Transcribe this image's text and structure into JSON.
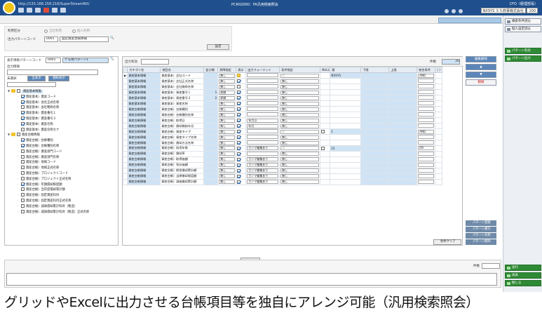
{
  "topbar": {
    "url": "http://133.166.158.216/SuperStreamNX/",
    "screen_code": "PCR02000：FA汎用検索照会",
    "user": "CFO（経理部長）",
    "company": "NXSYS ＳＳ商事株式会社",
    "zoom": "100"
  },
  "sidebar": {
    "buttons": [
      "検索条件読込",
      "個人設定読込",
      "パターン有効",
      "パターン出力",
      "実行",
      "再表",
      "閉じる"
    ],
    "colors": {
      "green": "#2f8a35"
    }
  },
  "condition": {
    "usage_label": "利用区分",
    "radio1": "全社利用",
    "radio2": "個人利用",
    "output_pattern_label": "出力パターンコード",
    "output_pattern_code": "0001",
    "output_pattern_name": "固定資産台帳情報",
    "set_button": "設定"
  },
  "left": {
    "display_pattern_label": "表示項目パターンコード",
    "display_pattern_code": "0001",
    "display_pattern_name": "デモ用パターン1",
    "output_info_label": "出力情報",
    "no_select_label": "未選択",
    "show_all": "全表示",
    "select_show": "選択表示"
  },
  "tree": [
    {
      "label": "資産基本情報",
      "level": 0,
      "check": false,
      "folder": true,
      "hl": true
    },
    {
      "label": "資産基本）資産コード",
      "level": 1,
      "check": true
    },
    {
      "label": "資産基本）会社正式名称",
      "level": 1,
      "check": true
    },
    {
      "label": "資産基本）会社略称名称",
      "level": 1,
      "check": false
    },
    {
      "label": "資産基本）資産番号１",
      "level": 1,
      "check": true
    },
    {
      "label": "資産基本）資産番号２",
      "level": 1,
      "check": true
    },
    {
      "label": "資産基本）資産名称",
      "level": 1,
      "check": true
    },
    {
      "label": "資産基本）資産名称カナ",
      "level": 1,
      "check": false
    },
    {
      "label": "資産台帳情報",
      "level": 0,
      "check": false,
      "folder": true
    },
    {
      "label": "資産台帳）台帳種別",
      "level": 1,
      "check": true
    },
    {
      "label": "資産台帳）台帳種別名称",
      "level": 1,
      "check": true
    },
    {
      "label": "資産台帳）資産部門コード",
      "level": 1,
      "check": false
    },
    {
      "label": "資産台帳）資産部門名称",
      "level": 1,
      "check": false
    },
    {
      "label": "資産台帳）地域コード",
      "level": 1,
      "check": false
    },
    {
      "label": "資産台帳）地域正式名称",
      "level": 1,
      "check": false
    },
    {
      "label": "資産台帳）プロジェクトコード",
      "level": 1,
      "check": false
    },
    {
      "label": "資産台帳）プロジェクト正式名称",
      "level": 1,
      "check": false
    },
    {
      "label": "資産台帳）年額償却限度額",
      "level": 1,
      "check": true
    },
    {
      "label": "資産台帳）当年度償却累計額",
      "level": 1,
      "check": false
    },
    {
      "label": "資産台帳）固定資産科目",
      "level": 1,
      "check": false
    },
    {
      "label": "資産台帳）固定資産科目正式名称",
      "level": 1,
      "check": false
    },
    {
      "label": "資産台帳）減価償却累計科目（製造）",
      "level": 1,
      "check": false
    },
    {
      "label": "資産台帳）減価償却累計科目（製造）正式名称",
      "level": 1,
      "check": false
    }
  ],
  "grid": {
    "output_order_label": "出力有効",
    "count_label": "件数",
    "count": "20",
    "headers": [
      "",
      "カテゴリ名",
      "項目名",
      "並び順",
      "昇降指定",
      "表示",
      "出力フォーマット",
      "条件指定",
      "NULL",
      "値",
      "下限",
      "上限",
      "結合条件",
      "(  )"
    ],
    "rows": [
      {
        "cat": "資産基本情報",
        "item": "資産基本）会社コード",
        "order": "",
        "sort": "無し",
        "show": "y",
        "fmt": "",
        "cond": "＝",
        "null": "",
        "val": "NXSYS",
        "join": "AND",
        "b": true
      },
      {
        "cat": "資産基本情報",
        "item": "資産基本）会社正式名称",
        "order": "",
        "sort": "無し",
        "show": "c",
        "fmt": "",
        "cond": "無し",
        "null": "",
        "val": "",
        "join": "",
        "b": false
      },
      {
        "cat": "資産基本情報",
        "item": "資産基本）会社略称名称",
        "order": "",
        "sort": "無し",
        "show": "n",
        "fmt": "",
        "cond": "無し",
        "null": "",
        "val": "",
        "join": "",
        "b": false
      },
      {
        "cat": "資産基本情報",
        "item": "資産基本）資産番号１",
        "order": "1",
        "sort": "昇順",
        "show": "c",
        "fmt": "",
        "cond": "無し",
        "null": "",
        "val": "",
        "join": "",
        "b": false
      },
      {
        "cat": "資産基本情報",
        "item": "資産基本）資産番号２",
        "order": "2",
        "sort": "昇順",
        "show": "c",
        "fmt": "",
        "cond": "無し",
        "null": "",
        "val": "",
        "join": "",
        "b": false
      },
      {
        "cat": "資産基本情報",
        "item": "資産基本）資産名称",
        "order": "",
        "sort": "無し",
        "show": "c",
        "fmt": "",
        "cond": "無し",
        "null": "",
        "val": "",
        "join": "",
        "b": false
      },
      {
        "cat": "資産台帳情報",
        "item": "資産台帳）台帳種別",
        "order": "",
        "sort": "無し",
        "show": "c",
        "fmt": "",
        "cond": "無し",
        "null": "",
        "val": "",
        "join": "",
        "b": false
      },
      {
        "cat": "資産台帳情報",
        "item": "資産台帳）台帳種別名称",
        "order": "",
        "sort": "無し",
        "show": "c",
        "fmt": "",
        "cond": "無し",
        "null": "",
        "val": "",
        "join": "",
        "b": false
      },
      {
        "cat": "資産台帳情報",
        "item": "資産台帳）取得日",
        "order": "",
        "sort": "無し",
        "show": "c",
        "fmt": "年月日",
        "cond": "無し",
        "null": "",
        "val": "",
        "join": "",
        "b": false
      },
      {
        "cat": "資産台帳情報",
        "item": "資産台帳）償却開始年月",
        "order": "",
        "sort": "無し",
        "show": "c",
        "fmt": "年月",
        "cond": "無し",
        "null": "",
        "val": "",
        "join": "",
        "b": false
      },
      {
        "cat": "資産台帳情報",
        "item": "資産台帳）資産タイプ",
        "order": "",
        "sort": "無し",
        "show": "c",
        "fmt": "",
        "cond": "＝",
        "null": "n",
        "val": "1",
        "join": "AND",
        "b": true
      },
      {
        "cat": "資産台帳情報",
        "item": "資産台帳）資産タイプ名称",
        "order": "",
        "sort": "無し",
        "show": "c",
        "fmt": "",
        "cond": "無し",
        "null": "",
        "val": "",
        "join": "",
        "b": false
      },
      {
        "cat": "資産台帳情報",
        "item": "資産台帳）償却方法名称",
        "order": "",
        "sort": "無し",
        "show": "c",
        "fmt": "",
        "cond": "無し",
        "null": "",
        "val": "",
        "join": "",
        "b": false
      },
      {
        "cat": "資産台帳情報",
        "item": "資産台帳）耐用年数",
        "order": "",
        "sort": "無し",
        "show": "c",
        "fmt": "カンマ編集あり",
        "cond": "＝",
        "null": "n",
        "val": "15",
        "join": "OR",
        "b": true
      },
      {
        "cat": "資産台帳情報",
        "item": "資産台帳）償却率",
        "order": "",
        "sort": "無し",
        "show": "c",
        "fmt": "",
        "cond": "無し",
        "null": "",
        "val": "",
        "join": "",
        "b": false
      },
      {
        "cat": "資産台帳情報",
        "item": "資産台帳）取得価額",
        "order": "",
        "sort": "無し",
        "show": "c",
        "fmt": "カンマ編集あり",
        "cond": "無し",
        "null": "",
        "val": "",
        "join": "",
        "b": false
      },
      {
        "cat": "資産台帳情報",
        "item": "資産台帳）残存価額",
        "order": "",
        "sort": "無し",
        "show": "c",
        "fmt": "カンマ編集あり",
        "cond": "無し",
        "null": "",
        "val": "",
        "join": "",
        "b": false
      },
      {
        "cat": "資産台帳情報",
        "item": "資産台帳）期首償却累計額",
        "order": "",
        "sort": "無し",
        "show": "c",
        "fmt": "カンマ編集あり",
        "cond": "無し",
        "null": "",
        "val": "",
        "join": "",
        "b": false
      },
      {
        "cat": "資産台帳情報",
        "item": "資産台帳）当期償却限度額",
        "order": "",
        "sort": "無し",
        "show": "c",
        "fmt": "カンマ編集あり",
        "cond": "無し",
        "null": "",
        "val": "",
        "join": "",
        "b": false
      },
      {
        "cat": "資産台帳情報",
        "item": "資産台帳）減価償却累計額",
        "order": "",
        "sort": "無し",
        "show": "c",
        "fmt": "カンマ編集あり",
        "cond": "無し",
        "null": "",
        "val": "",
        "join": "",
        "b": false
      }
    ]
  },
  "right_buttons": {
    "delete_row": "編集解除",
    "up": "▲",
    "down": "▼",
    "remove": "削除",
    "pattern_register": "パターン登録",
    "pattern_copy": "パターン複写",
    "pattern_rename": "パターン名称",
    "pattern_delete": "パターン削除",
    "cond_clear": "条件クリア"
  },
  "bottom": {
    "count_label": "件数"
  },
  "caption": "グリッドやExcelに出力させる台帳項目等を独自にアレンジ可能（汎用検索照会）"
}
